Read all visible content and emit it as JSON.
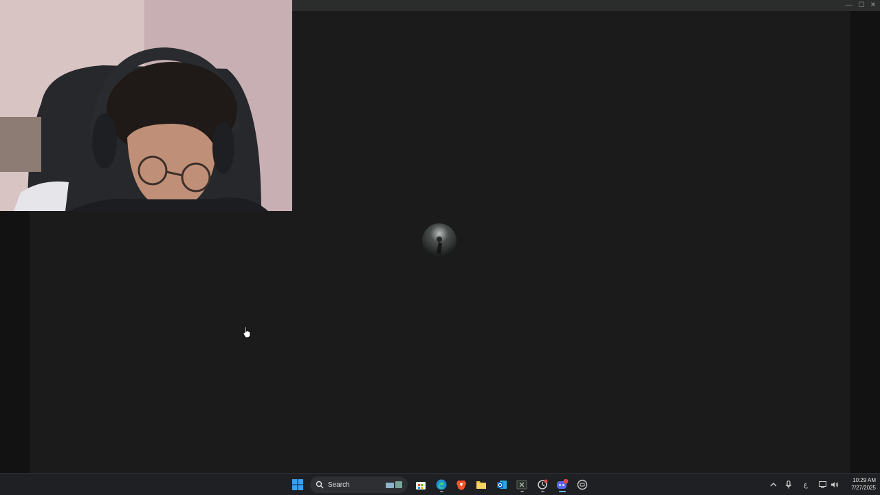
{
  "window": {
    "title": "",
    "controls": {
      "minimize_icon": "minimize-icon",
      "maximize_icon": "maximize-icon",
      "close_icon": "close-icon"
    }
  },
  "app": {
    "background_color": "#1a1b1a",
    "loading_indicator": "loading-orb"
  },
  "overlay": {
    "webcam_feed": "webcam-person-with-headset"
  },
  "taskbar": {
    "search": {
      "label": "Search",
      "icon": "search-icon"
    },
    "pinned": [
      {
        "name": "start",
        "icon": "windows-logo-icon"
      },
      {
        "name": "microsoft-store",
        "icon": "store-icon"
      },
      {
        "name": "edge",
        "icon": "edge-icon"
      },
      {
        "name": "brave",
        "icon": "brave-icon"
      },
      {
        "name": "file-explorer",
        "icon": "folder-icon"
      },
      {
        "name": "outlook",
        "icon": "outlook-icon"
      },
      {
        "name": "excel",
        "icon": "excel-icon"
      },
      {
        "name": "app-with-badge",
        "icon": "sync-icon"
      },
      {
        "name": "discord",
        "icon": "discord-icon",
        "badge": "61"
      },
      {
        "name": "app-circle",
        "icon": "circle-app-icon"
      }
    ],
    "tray": {
      "chevron_icon": "chevron-up-icon",
      "mic_icon": "microphone-icon",
      "language": "ع",
      "network_icon": "network-icon",
      "volume_icon": "volume-icon"
    },
    "clock": {
      "time": "10:29 AM",
      "date": "7/27/2025"
    }
  }
}
